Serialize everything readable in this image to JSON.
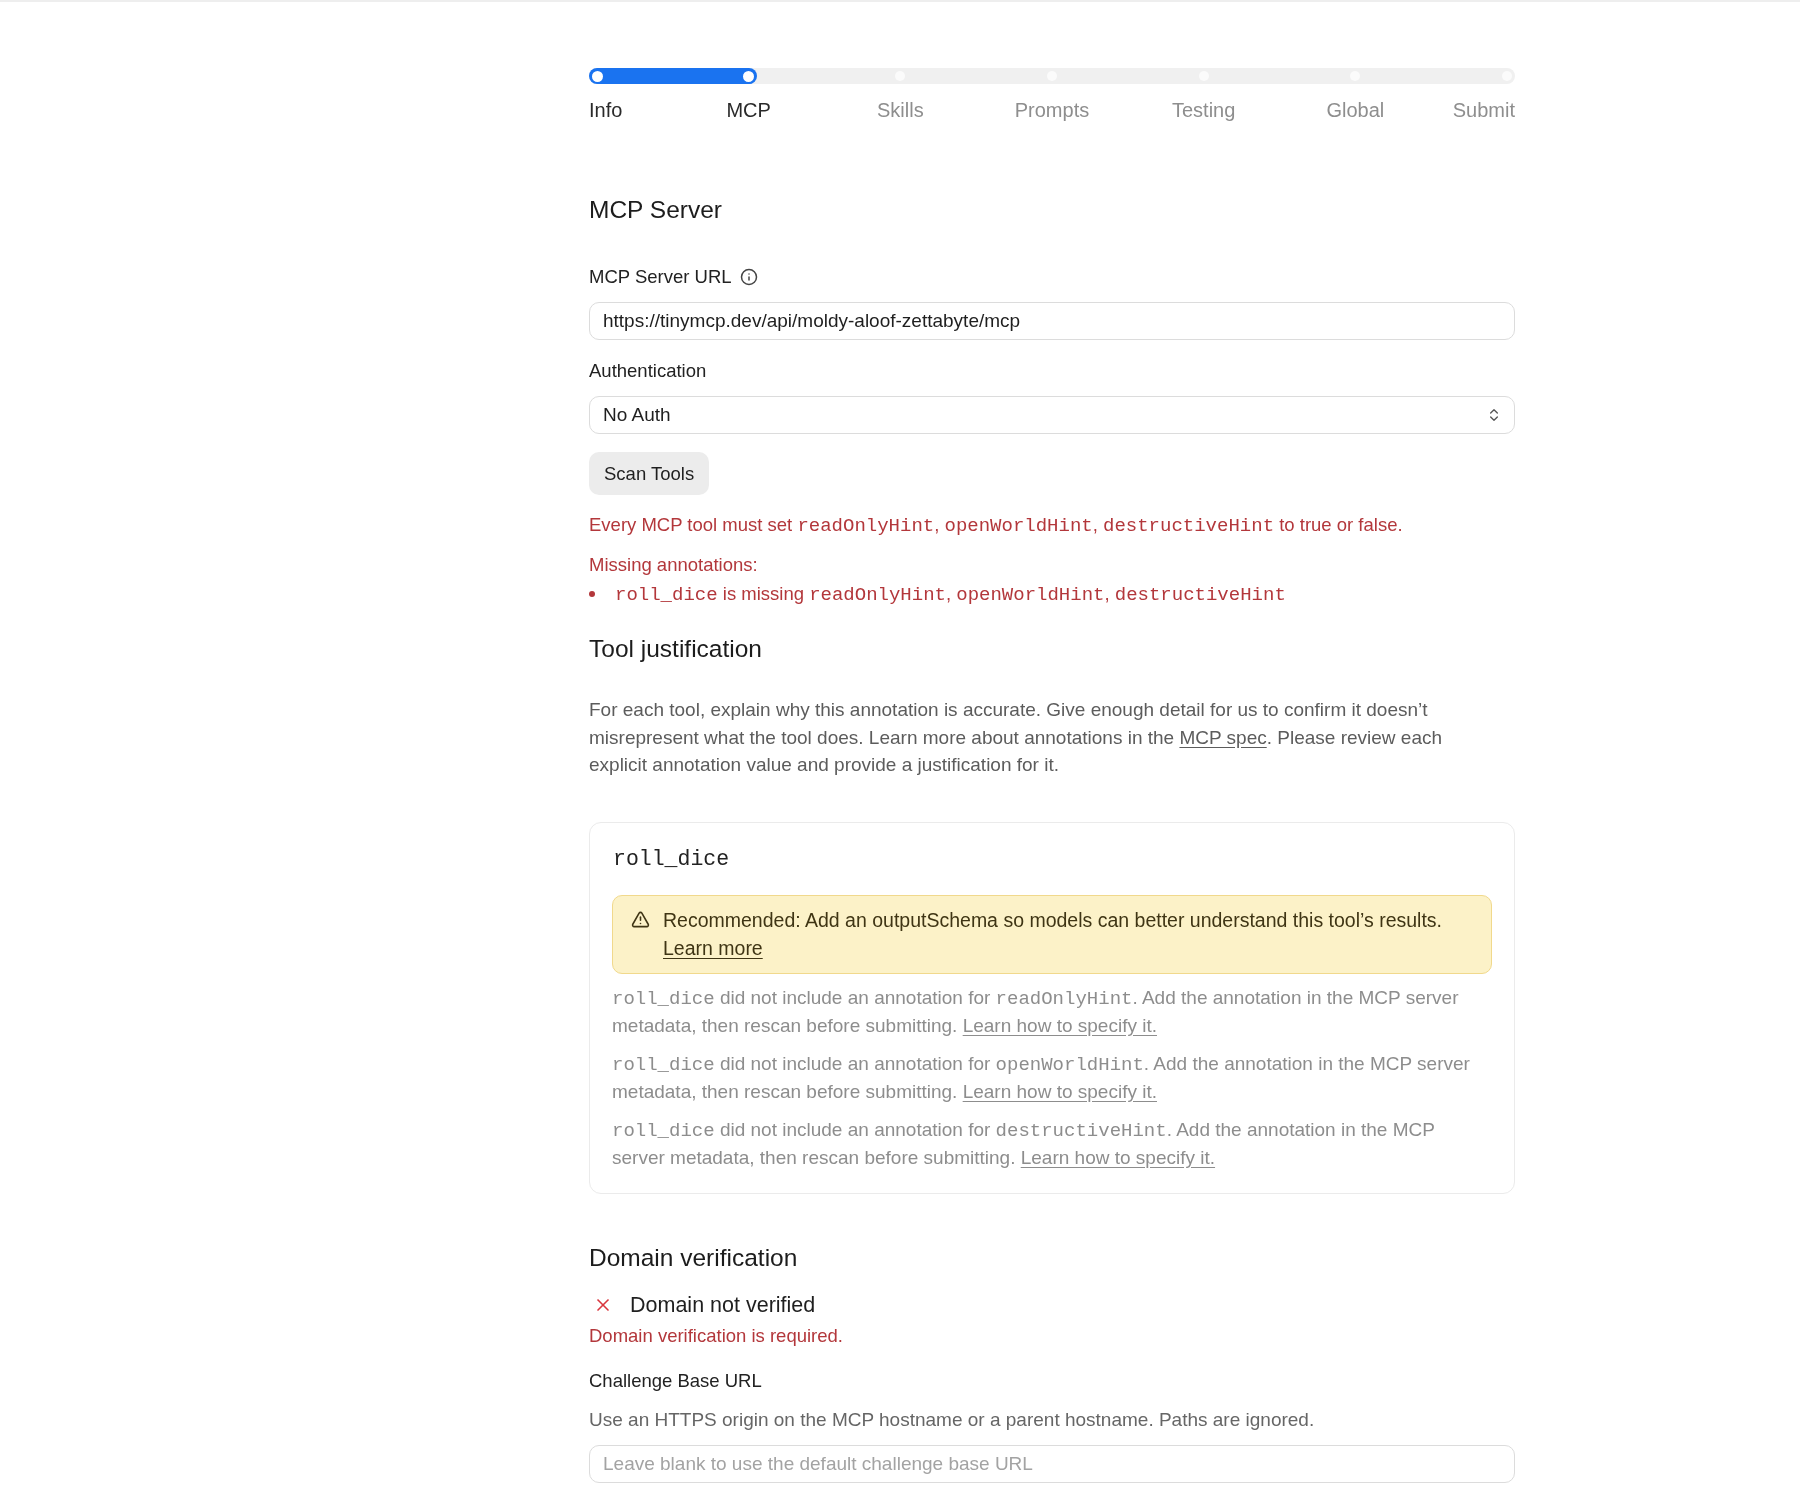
{
  "stepper": {
    "steps": [
      {
        "label": "Info",
        "reached": true,
        "selected": false
      },
      {
        "label": "MCP",
        "reached": true,
        "selected": true
      },
      {
        "label": "Skills",
        "reached": false,
        "selected": false
      },
      {
        "label": "Prompts",
        "reached": false,
        "selected": false
      },
      {
        "label": "Testing",
        "reached": false,
        "selected": false
      },
      {
        "label": "Global",
        "reached": false,
        "selected": false
      },
      {
        "label": "Submit",
        "reached": false,
        "selected": false
      }
    ]
  },
  "mcp_server": {
    "heading": "MCP Server",
    "url": {
      "label": "MCP Server URL",
      "value": "https://tinymcp.dev/api/moldy-aloof-zettabyte/mcp"
    },
    "authentication": {
      "label": "Authentication",
      "value": "No Auth"
    },
    "scan_button": "Scan Tools",
    "error": [
      {
        "kind": "text",
        "text": "Every MCP tool must set "
      },
      {
        "kind": "code",
        "text": "readOnlyHint"
      },
      {
        "kind": "text",
        "text": ", "
      },
      {
        "kind": "code",
        "text": "openWorldHint"
      },
      {
        "kind": "text",
        "text": ", "
      },
      {
        "kind": "code",
        "text": "destructiveHint"
      },
      {
        "kind": "text",
        "text": " to true or false."
      }
    ],
    "missing": {
      "title": "Missing annotations:",
      "items": [
        {
          "segments": [
            {
              "kind": "code",
              "text": "roll_dice"
            },
            {
              "kind": "text",
              "text": " is missing "
            },
            {
              "kind": "code",
              "text": "readOnlyHint"
            },
            {
              "kind": "text",
              "text": ", "
            },
            {
              "kind": "code",
              "text": "openWorldHint"
            },
            {
              "kind": "text",
              "text": ", "
            },
            {
              "kind": "code",
              "text": "destructiveHint"
            }
          ]
        }
      ]
    }
  },
  "tool_justification": {
    "heading": "Tool justification",
    "description": [
      {
        "kind": "text",
        "text": "For each tool, explain why this annotation is accurate. Give enough detail for us to confirm it doesn’t misrepresent what the tool does. Learn more about annotations in the "
      },
      {
        "kind": "link",
        "text": "MCP spec"
      },
      {
        "kind": "text",
        "text": ". Please review each explicit annotation value and provide a justification for it."
      }
    ],
    "tools": [
      {
        "name": "roll_dice",
        "recommendation": {
          "text": "Recommended: Add an outputSchema so models can better understand this tool’s results.",
          "link": "Learn more"
        },
        "notes": [
          {
            "segments": [
              {
                "kind": "code",
                "text": "roll_dice"
              },
              {
                "kind": "text",
                "text": " did not include an annotation for "
              },
              {
                "kind": "code",
                "text": "readOnlyHint"
              },
              {
                "kind": "text",
                "text": ". Add the annotation in the MCP server metadata, then rescan before submitting. "
              },
              {
                "kind": "link",
                "text": "Learn how to specify it."
              }
            ]
          },
          {
            "segments": [
              {
                "kind": "code",
                "text": "roll_dice"
              },
              {
                "kind": "text",
                "text": " did not include an annotation for "
              },
              {
                "kind": "code",
                "text": "openWorldHint"
              },
              {
                "kind": "text",
                "text": ". Add the annotation in the MCP server metadata, then rescan before submitting. "
              },
              {
                "kind": "link",
                "text": "Learn how to specify it."
              }
            ]
          },
          {
            "segments": [
              {
                "kind": "code",
                "text": "roll_dice"
              },
              {
                "kind": "text",
                "text": " did not include an annotation for "
              },
              {
                "kind": "code",
                "text": "destructiveHint"
              },
              {
                "kind": "text",
                "text": ". Add the annotation in the MCP server metadata, then rescan before submitting. "
              },
              {
                "kind": "link",
                "text": "Learn how to specify it."
              }
            ]
          }
        ]
      }
    ]
  },
  "domain_verification": {
    "heading": "Domain verification",
    "status": {
      "verified": false,
      "text": "Domain not verified"
    },
    "error": "Domain verification is required.",
    "challenge": {
      "label": "Challenge Base URL",
      "help": "Use an HTTPS origin on the MCP hostname or a parent hostname. Paths are ignored.",
      "placeholder": "Leave blank to use the default challenge base URL"
    }
  }
}
